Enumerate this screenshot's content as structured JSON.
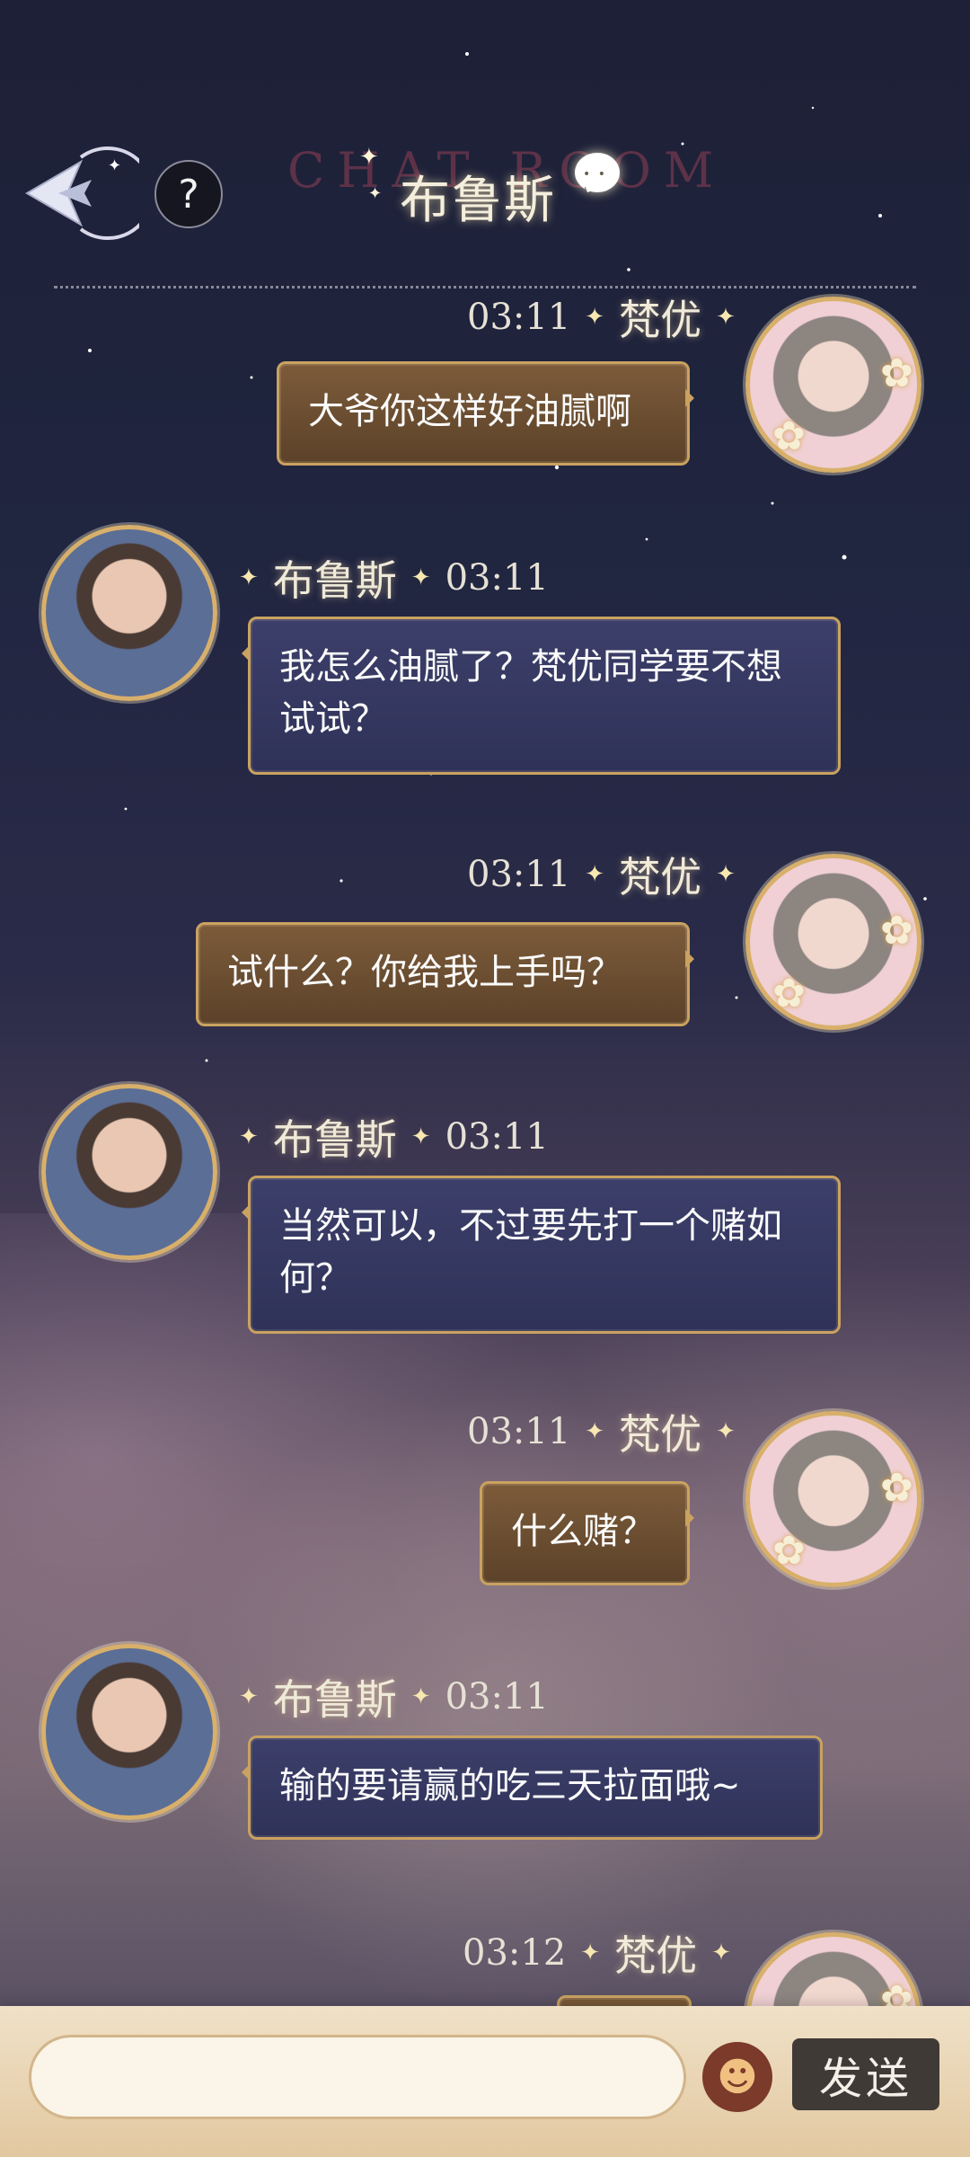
{
  "header": {
    "title": "布鲁斯",
    "background_text": "CHAT ROOM",
    "help_label": "?"
  },
  "messages": [
    {
      "sender": "梵优",
      "time": "03:11",
      "text": "大爷你这样好油腻啊",
      "side": "right"
    },
    {
      "sender": "布鲁斯",
      "time": "03:11",
      "text": "我怎么油腻了？梵优同学要不想试试？",
      "side": "left"
    },
    {
      "sender": "梵优",
      "time": "03:11",
      "text": "试什么？你给我上手吗？",
      "side": "right"
    },
    {
      "sender": "布鲁斯",
      "time": "03:11",
      "text": "当然可以，不过要先打一个赌如何？",
      "side": "left"
    },
    {
      "sender": "梵优",
      "time": "03:11",
      "text": "什么赌？",
      "side": "right"
    },
    {
      "sender": "布鲁斯",
      "time": "03:11",
      "text": "输的要请赢的吃三天拉面哦~",
      "side": "left"
    },
    {
      "sender": "梵优",
      "time": "03:12",
      "text": "",
      "side": "right"
    }
  ],
  "input": {
    "placeholder": "",
    "send_label": "发送"
  },
  "colors": {
    "right_bubble": "#6d4e31",
    "left_bubble": "#343760",
    "gold_border": "#caa260",
    "send_button": "#403a36"
  },
  "icons": {
    "back": "back-arrow-icon",
    "help": "help-icon",
    "chat": "chat-bubble-icon",
    "emoji": "emoji-icon"
  }
}
